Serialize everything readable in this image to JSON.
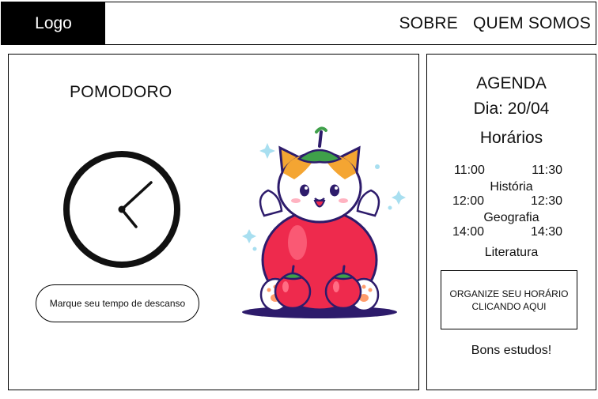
{
  "header": {
    "logo": "Logo",
    "nav": [
      "SOBRE",
      "QUEM SOMOS"
    ]
  },
  "pomodoro": {
    "title": "POMODORO",
    "rest_button": "Marque seu tempo de descanso",
    "illustration": "cat-in-tomato-costume"
  },
  "agenda": {
    "title": "AGENDA",
    "day": "Dia: 20/04",
    "hours_title": "Horários",
    "slots": [
      {
        "start": "11:00",
        "end": "11:30",
        "subject": "História"
      },
      {
        "start": "12:00",
        "end": "12:30",
        "subject": "Geografia"
      },
      {
        "start": "14:00",
        "end": "14:30",
        "subject": "Literatura"
      }
    ],
    "organize_button": "ORGANIZE SEU HORÁRIO CLICANDO AQUI",
    "closing": "Bons estudos!"
  },
  "colors": {
    "tomato": "#ee2a4d",
    "ear_orange": "#f4a532",
    "leaf": "#3fa04a",
    "ground": "#2d1b6b",
    "sparkle": "#a8dff0"
  }
}
